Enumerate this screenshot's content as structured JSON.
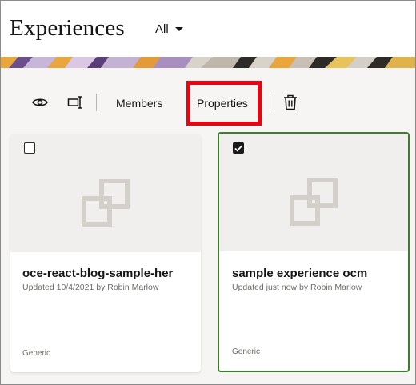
{
  "header": {
    "title": "Experiences",
    "filter_label": "All"
  },
  "toolbar": {
    "view_icon": "eye-icon",
    "edit_icon": "rename-cursor-icon",
    "members_label": "Members",
    "properties_label": "Properties",
    "delete_icon": "trash-icon"
  },
  "highlight_color": "#e30613",
  "selected_border_color": "#3e7d2b",
  "cards": [
    {
      "title": "oce-react-blog-sample-her",
      "meta": "Updated 10/4/2021 by Robin Marlow",
      "type": "Generic",
      "selected": false,
      "thumb_icon": "experience-placeholder-icon"
    },
    {
      "title": "sample experience ocm",
      "meta": "Updated just now by Robin Marlow",
      "type": "Generic",
      "selected": true,
      "thumb_icon": "experience-placeholder-icon"
    }
  ]
}
